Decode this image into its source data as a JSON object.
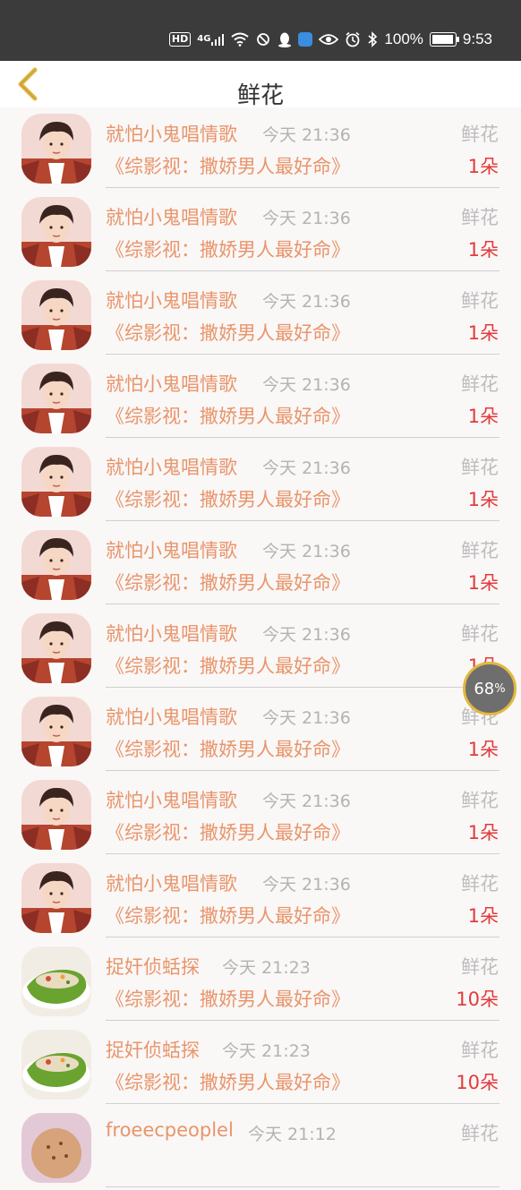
{
  "statusbar": {
    "network": "HD",
    "signal": "4G",
    "battery": "100%",
    "battery_level": 1.0,
    "time": "9:53"
  },
  "header": {
    "title": "鲜花"
  },
  "list": [
    {
      "name": "就怕小鬼唱情歌",
      "time": "今天 21:36",
      "gift": "鲜花",
      "work": "《综影视：撒娇男人最好命》",
      "qty": "1朵",
      "avatar": "portrait"
    },
    {
      "name": "就怕小鬼唱情歌",
      "time": "今天 21:36",
      "gift": "鲜花",
      "work": "《综影视：撒娇男人最好命》",
      "qty": "1朵",
      "avatar": "portrait"
    },
    {
      "name": "就怕小鬼唱情歌",
      "time": "今天 21:36",
      "gift": "鲜花",
      "work": "《综影视：撒娇男人最好命》",
      "qty": "1朵",
      "avatar": "portrait"
    },
    {
      "name": "就怕小鬼唱情歌",
      "time": "今天 21:36",
      "gift": "鲜花",
      "work": "《综影视：撒娇男人最好命》",
      "qty": "1朵",
      "avatar": "portrait"
    },
    {
      "name": "就怕小鬼唱情歌",
      "time": "今天 21:36",
      "gift": "鲜花",
      "work": "《综影视：撒娇男人最好命》",
      "qty": "1朵",
      "avatar": "portrait"
    },
    {
      "name": "就怕小鬼唱情歌",
      "time": "今天 21:36",
      "gift": "鲜花",
      "work": "《综影视：撒娇男人最好命》",
      "qty": "1朵",
      "avatar": "portrait"
    },
    {
      "name": "就怕小鬼唱情歌",
      "time": "今天 21:36",
      "gift": "鲜花",
      "work": "《综影视：撒娇男人最好命》",
      "qty": "1朵",
      "avatar": "portrait"
    },
    {
      "name": "就怕小鬼唱情歌",
      "time": "今天 21:36",
      "gift": "鲜花",
      "work": "《综影视：撒娇男人最好命》",
      "qty": "1朵",
      "avatar": "portrait"
    },
    {
      "name": "就怕小鬼唱情歌",
      "time": "今天 21:36",
      "gift": "鲜花",
      "work": "《综影视：撒娇男人最好命》",
      "qty": "1朵",
      "avatar": "portrait"
    },
    {
      "name": "就怕小鬼唱情歌",
      "time": "今天 21:36",
      "gift": "鲜花",
      "work": "《综影视：撒娇男人最好命》",
      "qty": "1朵",
      "avatar": "portrait"
    },
    {
      "name": "捉奸侦蛞探",
      "time": "今天 21:23",
      "gift": "鲜花",
      "work": "《综影视：撒娇男人最好命》",
      "qty": "10朵",
      "avatar": "food"
    },
    {
      "name": "捉奸侦蛞探",
      "time": "今天 21:23",
      "gift": "鲜花",
      "work": "《综影视：撒娇男人最好命》",
      "qty": "10朵",
      "avatar": "food"
    },
    {
      "name": "froeecpeoplel",
      "time": "今天 21:12",
      "gift": "鲜花",
      "work": "",
      "qty": "",
      "avatar": "round"
    }
  ],
  "floating_badge": {
    "value": "68",
    "unit": "%"
  },
  "colors": {
    "accent": "#e8956a",
    "quantity": "#e23b3b",
    "back_icon": "#e2b83d",
    "statusbar_bg": "#3b3b3b"
  },
  "icons": [
    "back-arrow-icon",
    "wifi-icon",
    "eye-icon",
    "alarm-icon",
    "bluetooth-icon",
    "battery-icon",
    "qq-icon"
  ]
}
